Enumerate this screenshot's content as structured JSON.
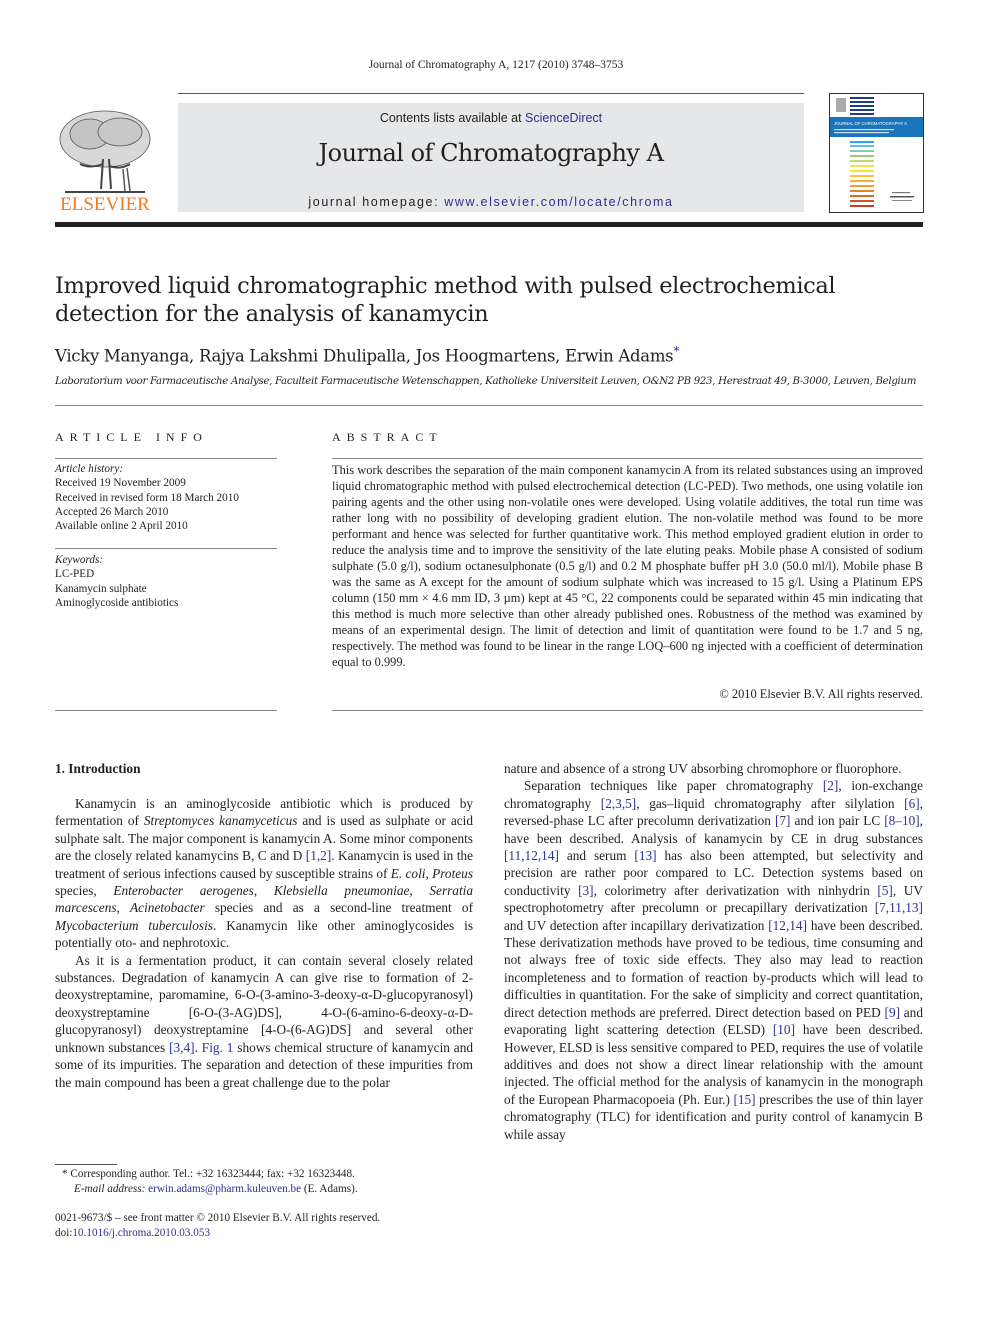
{
  "header": {
    "citation": "Journal of Chromatography A, 1217 (2010) 3748–3753",
    "contents_prefix": "Contents lists available at ",
    "contents_link": "ScienceDirect",
    "journal_title": "Journal of Chromatography A",
    "homepage_prefix": "journal homepage: ",
    "homepage_url": "www.elsevier.com/locate/chroma",
    "publisher_logo": "ELSEVIER",
    "cover_title": "JOURNAL OF CHROMATOGRAPHY A"
  },
  "article": {
    "title": "Improved liquid chromatographic method with pulsed electrochemical detection for the analysis of kanamycin",
    "authors": "Vicky Manyanga, Rajya Lakshmi Dhulipalla, Jos Hoogmartens, Erwin Adams",
    "corresponding_mark": "*",
    "affiliation": "Laboratorium voor Farmaceutische Analyse, Faculteit Farmaceutische Wetenschappen, Katholieke Universiteit Leuven, O&N2 PB 923, Herestraat 49, B-3000, Leuven, Belgium"
  },
  "article_info": {
    "heading": "ARTICLE INFO",
    "history_label": "Article history:",
    "history": [
      "Received 19 November 2009",
      "Received in revised form 18 March 2010",
      "Accepted 26 March 2010",
      "Available online 2 April 2010"
    ],
    "keywords_label": "Keywords:",
    "keywords": [
      "LC-PED",
      "Kanamycin sulphate",
      "Aminoglycoside antibiotics"
    ]
  },
  "abstract": {
    "heading": "ABSTRACT",
    "text": "This work describes the separation of the main component kanamycin A from its related substances using an improved liquid chromatographic method with pulsed electrochemical detection (LC-PED). Two methods, one using volatile ion pairing agents and the other using non-volatile ones were developed. Using volatile additives, the total run time was rather long with no possibility of developing gradient elution. The non-volatile method was found to be more performant and hence was selected for further quantitative work. This method employed gradient elution in order to reduce the analysis time and to improve the sensitivity of the late eluting peaks. Mobile phase A consisted of sodium sulphate (5.0 g/l), sodium octanesulphonate (0.5 g/l) and 0.2 M phosphate buffer pH 3.0 (50.0 ml/l). Mobile phase B was the same as A except for the amount of sodium sulphate which was increased to 15 g/l. Using a Platinum EPS column (150 mm × 4.6 mm ID, 3 µm) kept at 45 °C, 22 components could be separated within 45 min indicating that this method is much more selective than other already published ones. Robustness of the method was examined by means of an experimental design. The limit of detection and limit of quantitation were found to be 1.7 and 5 ng, respectively. The method was found to be linear in the range LOQ–600 ng injected with a coefficient of determination equal to 0.999.",
    "copyright": "© 2010 Elsevier B.V. All rights reserved."
  },
  "intro": {
    "heading": "1.  Introduction",
    "p1_a": "Kanamycin is an aminoglycoside antibiotic which is produced by fermentation of ",
    "p1_b": "Streptomyces kanamyceticus",
    "p1_c": " and is used as sulphate or acid sulphate salt. The major component is kanamycin A. Some minor components are the closely related kanamycins B, C and D ",
    "p1_ref1": "[1,2]",
    "p1_d": ". Kanamycin is used in the treatment of serious infections caused by susceptible strains of ",
    "p1_e": "E. coli",
    "p1_f": ", ",
    "p1_g": "Proteus",
    "p1_h": " species, ",
    "p1_i": "Enterobacter aerogenes",
    "p1_j": ", ",
    "p1_k": "Klebsiella pneumoniae",
    "p1_l": ", ",
    "p1_m": "Serratia marcescens",
    "p1_n": ", ",
    "p1_o": "Acinetobacter",
    "p1_p": " species and as a second-line treatment of ",
    "p1_q": "Mycobacterium tuberculosis",
    "p1_r": ". Kanamycin like other aminoglycosides is potentially oto- and nephrotoxic.",
    "p2_a": "As it is a fermentation product, it can contain several closely related substances. Degradation of kanamycin A can give rise to formation of 2-deoxystreptamine, paromamine, 6-O-(3-amino-3-deoxy-α-D-glucopyranosyl) deoxystreptamine [6-O-(3-AG)DS], 4-O-(6-amino-6-deoxy-α-D-glucopyranosyl) deoxystreptamine [4-O-(6-AG)DS] and several other unknown substances ",
    "p2_ref": "[3,4]",
    "p2_b": ". ",
    "p2_fig": "Fig. 1",
    "p2_c": " shows chemical structure of kanamycin and some of its impurities. The separation and detection of these impurities from the main compound has been a great challenge due to the polar nature and absence of a strong UV absorbing chromophore or fluorophore.",
    "p3": [
      {
        "t": "Separation techniques like paper chromatography "
      },
      {
        "r": "[2]"
      },
      {
        "t": ", ion-exchange chromatography "
      },
      {
        "r": "[2,3,5]"
      },
      {
        "t": ", gas–liquid chromatography after silylation "
      },
      {
        "r": "[6]"
      },
      {
        "t": ", reversed-phase LC after precolumn derivatization "
      },
      {
        "r": "[7]"
      },
      {
        "t": " and ion pair LC "
      },
      {
        "r": "[8–10]"
      },
      {
        "t": ", have been described. Analysis of kanamycin by CE in drug substances "
      },
      {
        "r": "[11,12,14]"
      },
      {
        "t": " and serum "
      },
      {
        "r": "[13]"
      },
      {
        "t": " has also been attempted, but selectivity and precision are rather poor compared to LC. Detection systems based on conductivity "
      },
      {
        "r": "[3]"
      },
      {
        "t": ", colorimetry after derivatization with ninhydrin "
      },
      {
        "r": "[5]"
      },
      {
        "t": ", UV spectrophotometry after precolumn or precapillary derivatization "
      },
      {
        "r": "[7,11,13]"
      },
      {
        "t": " and UV detection after incapillary derivatization "
      },
      {
        "r": "[12,14]"
      },
      {
        "t": " have been described. These derivatization methods have proved to be tedious, time consuming and not always free of toxic side effects. They also may lead to reaction incompleteness and to formation of reaction by-products which will lead to difficulties in quantitation. For the sake of simplicity and correct quantitation, direct detection methods are preferred. Direct detection based on PED "
      },
      {
        "r": "[9]"
      },
      {
        "t": " and evaporating light scattering detection (ELSD) "
      },
      {
        "r": "[10]"
      },
      {
        "t": " have been described. However, ELSD is less sensitive compared to PED, requires the use of volatile additives and does not show a direct linear relationship with the amount injected. The official method for the analysis of kanamycin in the monograph of the European Pharmacopoeia (Ph. Eur.) "
      },
      {
        "r": "[15]"
      },
      {
        "t": " prescribes the use of thin layer chromatography (TLC) for identification and purity control of kanamycin B while assay"
      }
    ]
  },
  "footnotes": {
    "corresponding": "* Corresponding author. Tel.: +32 16323444; fax: +32 16323448.",
    "email_label": "E-mail address: ",
    "email": "erwin.adams@pharm.kuleuven.be",
    "email_suffix": " (E. Adams).",
    "front_matter": "0021-9673/$ – see front matter © 2010 Elsevier B.V. All rights reserved.",
    "doi_label": "doi:",
    "doi": "10.1016/j.chroma.2010.03.053"
  }
}
